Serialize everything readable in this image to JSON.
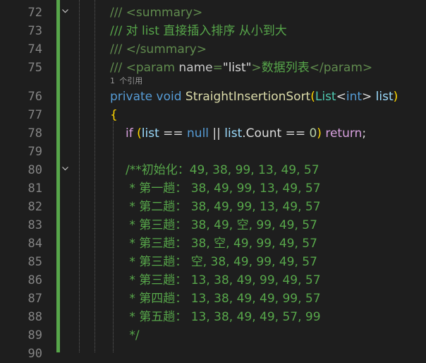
{
  "colors": {
    "background": "#1e1e1e",
    "change_bar": "#57a64a",
    "comment": "#57a64a",
    "keyword": "#569cd6",
    "type": "#4ec9b0",
    "method": "#dcdcaa",
    "identifier": "#9cdcfe",
    "number": "#b5cea8",
    "string": "#d69d85",
    "line_number": "#858585"
  },
  "fold_icon": "chevron-down-icon",
  "codelens": "1 个引用",
  "lines": {
    "l72": {
      "num": "72",
      "prefix": "/// ",
      "tag": "<summary>"
    },
    "l73": {
      "num": "73",
      "text": "/// 对 list 直接插入排序 从小到大"
    },
    "l74": {
      "num": "74",
      "prefix": "/// ",
      "tag": "</summary>"
    },
    "l75": {
      "num": "75",
      "prefix": "/// ",
      "open": "<param ",
      "attr": "name",
      "eq": "=",
      "val": "\"list\"",
      "close": ">",
      "desc": "数据列表",
      "end": "</param>"
    },
    "l76": {
      "num": "76",
      "kw1": "private",
      "kw2": "void",
      "name": "StraightInsertionSort",
      "p1": "(",
      "type": "List",
      "lt": "<",
      "int": "int",
      "gt": ">",
      "param": "list",
      "p2": ")"
    },
    "l77": {
      "num": "77",
      "brace": "{"
    },
    "l78": {
      "num": "78",
      "if": "if",
      "sp1": " (",
      "list": "list",
      "op": " == ",
      "null": "null",
      "or": " || ",
      "list2": "list",
      "dot": ".",
      "count": "Count",
      "op2": " == ",
      "zero": "0",
      "cp": ") ",
      "ret": "return",
      "semi": ";"
    },
    "l79": {
      "num": "79"
    },
    "l80": {
      "num": "80",
      "text": "/**初始化：49, 38, 99, 13, 49, 57"
    },
    "l81": {
      "num": "81",
      "text": " * 第一趟： 38, 49, 99, 13, 49, 57"
    },
    "l82": {
      "num": "82",
      "text": " * 第二趟： 38, 49, 99, 13, 49, 57"
    },
    "l83": {
      "num": "83",
      "text": " * 第三趟： 38, 49, 空, 99, 49, 57"
    },
    "l84": {
      "num": "84",
      "text": " * 第三趟： 38, 空, 49, 99, 49, 57"
    },
    "l85": {
      "num": "85",
      "text": " * 第三趟： 空, 38, 49, 99, 49, 57"
    },
    "l86": {
      "num": "86",
      "text": " * 第三趟： 13, 38, 49, 99, 49, 57"
    },
    "l87": {
      "num": "87",
      "text": " * 第四趟： 13, 38, 49, 49, 99, 57"
    },
    "l88": {
      "num": "88",
      "text": " * 第五趟： 13, 38, 49, 49, 57, 99"
    },
    "l89": {
      "num": "89",
      "text": " */"
    },
    "l90": {
      "num": "90"
    }
  }
}
